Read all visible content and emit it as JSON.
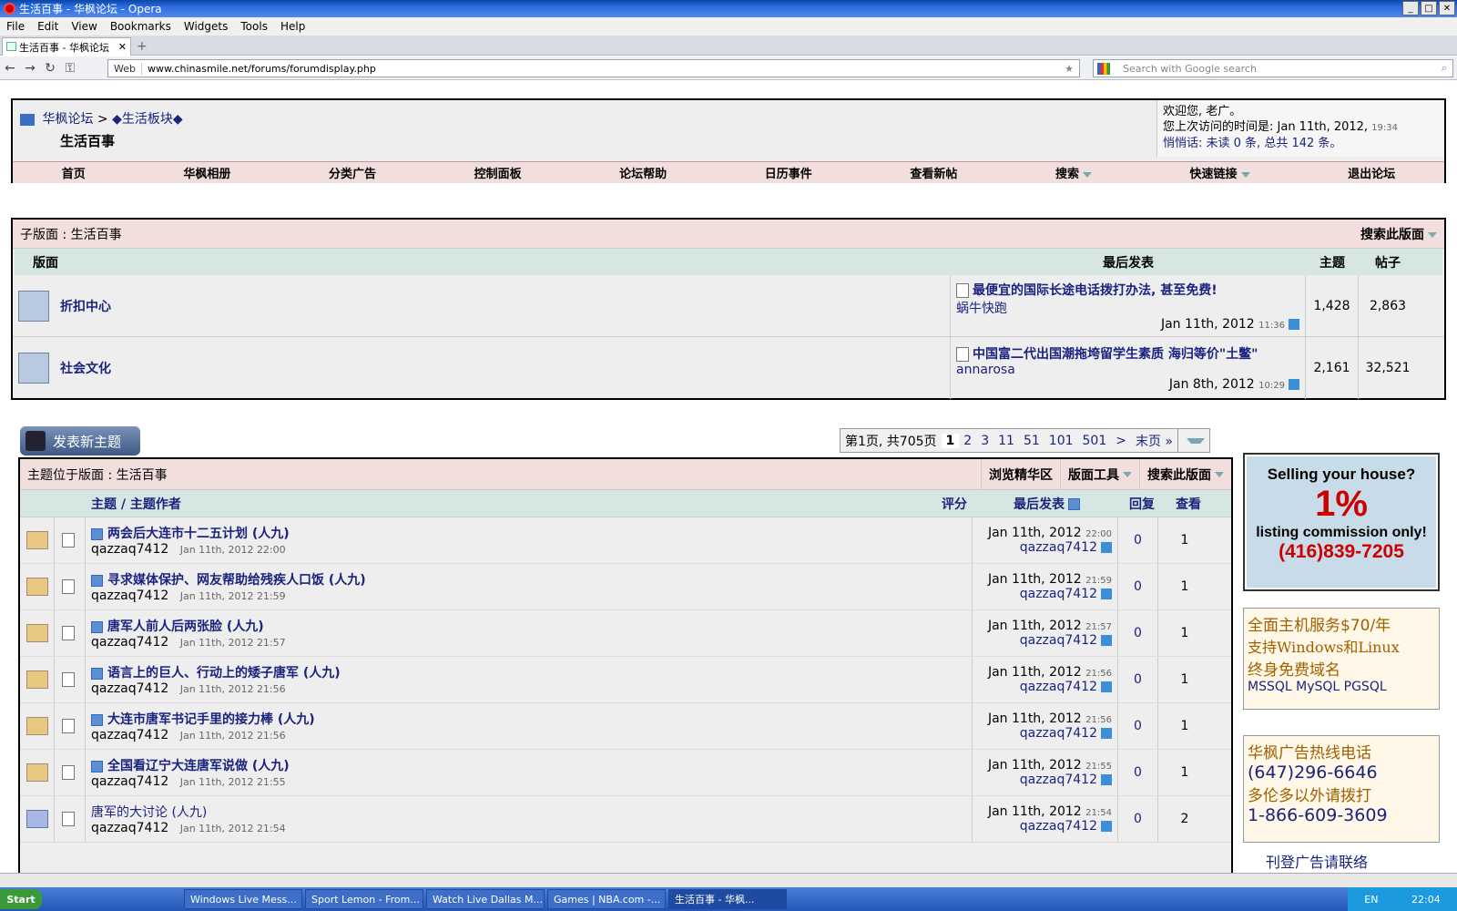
{
  "window": {
    "title": "生活百事 - 华枫论坛 - Opera"
  },
  "menu": [
    "File",
    "Edit",
    "View",
    "Bookmarks",
    "Widgets",
    "Tools",
    "Help"
  ],
  "tab": {
    "label": "生活百事 - 华枫论坛"
  },
  "address": {
    "scheme_label": "Web",
    "url": "www.chinasmile.net/forums/forumdisplay.php",
    "search_placeholder": "Search with Google search"
  },
  "header": {
    "crumb_root": "华枫论坛",
    "crumb_sep": ">",
    "crumb_sub": "◆生活板块◆",
    "title": "生活百事",
    "welcome": "欢迎您, 老广。",
    "last_visit": "您上次访问的时间是: Jan 11th, 2012,",
    "last_visit_time": "19:34",
    "pm": "悄悄话: 未读 0 条, 总共 142 条。"
  },
  "nav": [
    "首页",
    "华枫相册",
    "分类广告",
    "控制面板",
    "论坛帮助",
    "日历事件",
    "查看新帖",
    "搜索",
    "快速链接",
    "退出论坛"
  ],
  "subforums": {
    "heading": "子版面 : 生活百事",
    "search_label": "搜索此版面",
    "col_forum": "版面",
    "col_last": "最后发表",
    "col_threads": "主题",
    "col_posts": "帖子",
    "rows": [
      {
        "name": "折扣中心",
        "last_title": "最便宜的国际长途电话拨打办法, 甚至免费!",
        "last_user": "蜗牛快跑",
        "last_date": "Jan 11th, 2012",
        "last_time": "11:36",
        "threads": "1,428",
        "posts": "2,863"
      },
      {
        "name": "社会文化",
        "last_title": "中国富二代出国潮拖垮留学生素质 海归等价\"土鳖\"",
        "last_user": "annarosa",
        "last_date": "Jan 8th, 2012",
        "last_time": "10:29",
        "threads": "2,161",
        "posts": "32,521"
      }
    ]
  },
  "new_thread_label": "发表新主题",
  "pager": {
    "info": "第1页, 共705页",
    "pages": [
      "1",
      "2",
      "3",
      "11",
      "51",
      "101",
      "501",
      ">",
      "末页 »"
    ]
  },
  "threads": {
    "heading": "主题位于版面 : 生活百事",
    "tools": [
      "浏览精华区",
      "版面工具",
      "搜索此版面"
    ],
    "col_topic": "主题",
    "col_author": "主题作者",
    "col_rating": "评分",
    "col_last": "最后发表",
    "col_replies": "回复",
    "col_views": "查看",
    "rows": [
      {
        "title": "两会后大连市十二五计划 (人九)",
        "author": "qazzaq7412",
        "date": "Jan 11th, 2012 22:00",
        "last_date": "Jan 11th, 2012",
        "last_time": "22:00",
        "last_user": "qazzaq7412",
        "replies": "0",
        "views": "1"
      },
      {
        "title": "寻求媒体保护、网友帮助给残疾人口饭 (人九)",
        "author": "qazzaq7412",
        "date": "Jan 11th, 2012 21:59",
        "last_date": "Jan 11th, 2012",
        "last_time": "21:59",
        "last_user": "qazzaq7412",
        "replies": "0",
        "views": "1"
      },
      {
        "title": "唐军人前人后两张脸 (人九)",
        "author": "qazzaq7412",
        "date": "Jan 11th, 2012 21:57",
        "last_date": "Jan 11th, 2012",
        "last_time": "21:57",
        "last_user": "qazzaq7412",
        "replies": "0",
        "views": "1"
      },
      {
        "title": "语言上的巨人、行动上的矮子唐军 (人九)",
        "author": "qazzaq7412",
        "date": "Jan 11th, 2012 21:56",
        "last_date": "Jan 11th, 2012",
        "last_time": "21:56",
        "last_user": "qazzaq7412",
        "replies": "0",
        "views": "1"
      },
      {
        "title": "大连市唐军书记手里的接力棒 (人九)",
        "author": "qazzaq7412",
        "date": "Jan 11th, 2012 21:56",
        "last_date": "Jan 11th, 2012",
        "last_time": "21:56",
        "last_user": "qazzaq7412",
        "replies": "0",
        "views": "1"
      },
      {
        "title": "全国看辽宁大连唐军说做 (人九)",
        "author": "qazzaq7412",
        "date": "Jan 11th, 2012 21:55",
        "last_date": "Jan 11th, 2012",
        "last_time": "21:55",
        "last_user": "qazzaq7412",
        "replies": "0",
        "views": "1"
      },
      {
        "title": "唐军的大讨论 (人九)",
        "author": "qazzaq7412",
        "date": "Jan 11th, 2012 21:54",
        "last_date": "Jan 11th, 2012",
        "last_time": "21:54",
        "last_user": "qazzaq7412",
        "replies": "0",
        "views": "2"
      }
    ]
  },
  "ads": {
    "a1_l1": "Selling your house?",
    "a1_l2": "1%",
    "a1_l3": "listing commission only!",
    "a1_l4": "(416)839-7205",
    "a2_l1": "全面主机服务$70/年",
    "a2_l2": "支持Windows和Linux",
    "a2_l3": "终身免费域名",
    "a2_l4": "MSSQL MySQL PGSQL",
    "a3_l1": "华枫广告热线电话",
    "a3_l2": "(647)296-6646",
    "a3_l3": "多伦多以外请拨打",
    "a3_l4": "1-866-609-3609",
    "a4": "刊登广告请联络"
  },
  "taskbar": {
    "start": "Start",
    "tasks": [
      "Windows Live Mess...",
      "Sport Lemon - From...",
      "Watch Live Dallas M...",
      "Games | NBA.com -...",
      "生活百事 - 华枫..."
    ],
    "lang": "EN",
    "clock": "22:04"
  }
}
